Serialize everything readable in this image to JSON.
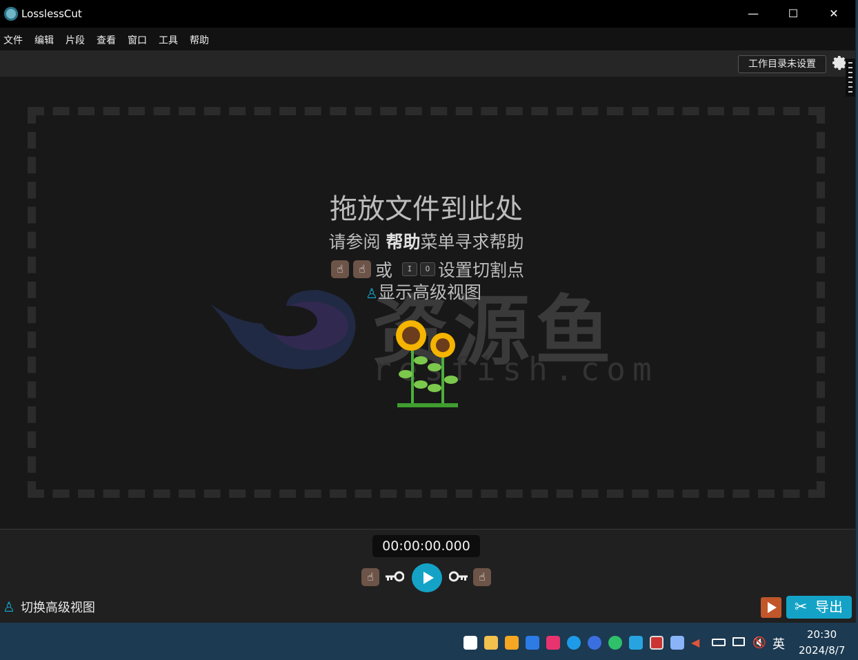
{
  "window": {
    "title": "LosslessCut",
    "minimize": "—",
    "maximize": "☐",
    "close": "✕"
  },
  "menu": [
    "文件",
    "编辑",
    "片段",
    "查看",
    "窗口",
    "工具",
    "帮助"
  ],
  "toolbar": {
    "workdir_label": "工作目录未设置"
  },
  "dropzone": {
    "title": "拖放文件到此处",
    "help_prefix": "请参阅 ",
    "help_bold": "帮助",
    "help_suffix": "菜单寻求帮助",
    "cut_or": "或",
    "key_in": "I",
    "key_out": "O",
    "cut_suffix": "设置切割点",
    "advanced_label": "显示高级视图"
  },
  "watermark": {
    "text": "资源鱼",
    "sub": "resfish.com"
  },
  "timeline": {
    "timecode": "00:00:00.000 (0)"
  },
  "bottom": {
    "toggle_advanced": "切换高级视图",
    "export_label": "导出"
  },
  "taskbar": {
    "ime": "英",
    "time": "20:30",
    "date": "2024/8/7"
  },
  "colors": {
    "accent": "#14a3c7",
    "hand": "#6d5448",
    "preview": "#c0562a"
  }
}
